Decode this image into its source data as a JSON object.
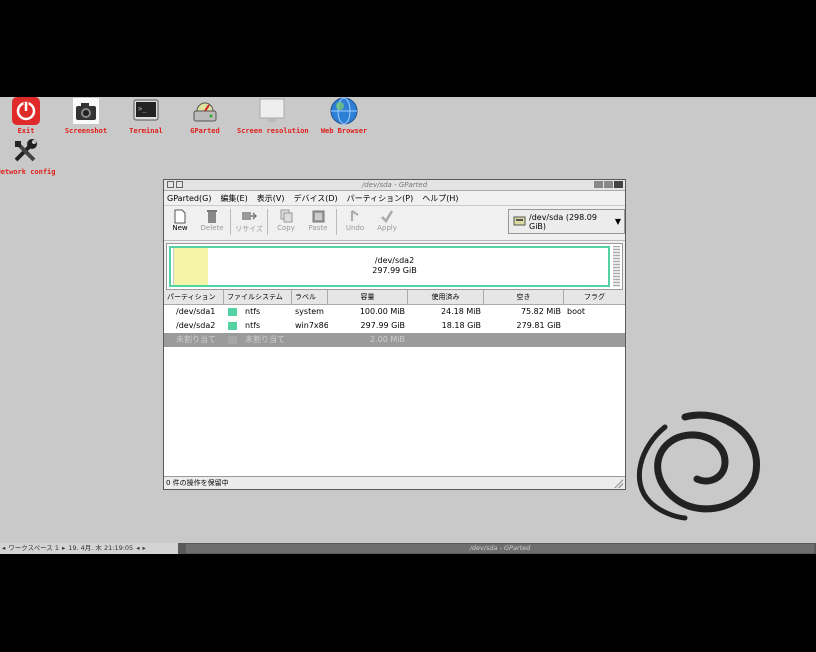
{
  "desktop": {
    "icons": [
      {
        "name": "exit",
        "label": "Exit"
      },
      {
        "name": "screenshot",
        "label": "Screenshot"
      },
      {
        "name": "terminal",
        "label": "Terminal"
      },
      {
        "name": "gparted",
        "label": "GParted"
      },
      {
        "name": "screen-resolution",
        "label": "Screen resolution"
      },
      {
        "name": "web-browser",
        "label": "Web Browser"
      },
      {
        "name": "network-config",
        "label": "Network config"
      }
    ]
  },
  "window": {
    "title": "/dev/sda - GParted",
    "menu": [
      "GParted(G)",
      "編集(E)",
      "表示(V)",
      "デバイス(D)",
      "パーティション(P)",
      "ヘルプ(H)"
    ],
    "toolbar": {
      "new": "New",
      "delete": "Delete",
      "resize": "リサイズ",
      "move": "移動",
      "copy": "Copy",
      "paste": "Paste",
      "undo": "Undo",
      "apply": "Apply"
    },
    "device": "/dev/sda (298.09 GiB)",
    "graph": {
      "name": "/dev/sda2",
      "size": "297.99 GiB"
    },
    "columns": [
      "パーティション",
      "ファイルシステム",
      "ラベル",
      "容量",
      "使用済み",
      "空き",
      "フラグ"
    ],
    "rows": [
      {
        "partition": "/dev/sda1",
        "fs": "ntfs",
        "fs_color": "#55d2a2",
        "label": "system",
        "size": "100.00 MiB",
        "used": "24.18 MiB",
        "free": "75.82 MiB",
        "flags": "boot"
      },
      {
        "partition": "/dev/sda2",
        "fs": "ntfs",
        "fs_color": "#55d2a2",
        "label": "win7x86",
        "size": "297.99 GiB",
        "used": "18.18 GiB",
        "free": "279.81 GiB",
        "flags": ""
      },
      {
        "partition": "未割り当て",
        "fs": "未割り当て",
        "fs_color": "#a6a6a6",
        "label": "",
        "size": "2.00 MiB",
        "used": "",
        "free": "",
        "flags": ""
      }
    ],
    "status": "0 件の操作を保留中"
  },
  "taskbar": {
    "workspace": "ワークスペース 1",
    "clock": "19. 4月. 木 21:19:05",
    "task": "/dev/sda - GParted"
  }
}
